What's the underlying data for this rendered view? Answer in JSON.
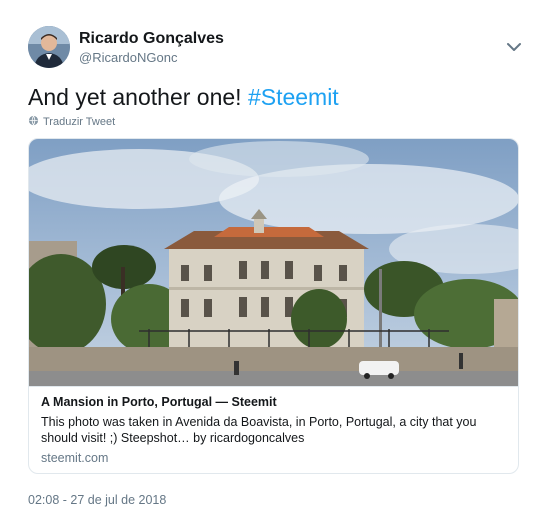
{
  "author": {
    "display_name": "Ricardo Gonçalves",
    "handle": "@RicardoNGonc"
  },
  "tweet": {
    "text_plain": "And yet another one! ",
    "hashtag": "#Steemit",
    "translate_label": "Traduzir Tweet",
    "timestamp": "02:08 - 27 de jul de 2018"
  },
  "card": {
    "title": "A Mansion in Porto, Portugal — Steemit",
    "description": "This photo was taken in Avenida da Boavista, in Porto, Portugal, a city that you should visit! ;) Steepshot… by ricardogoncalves",
    "domain": "steemit.com"
  },
  "icons": {
    "caret": "chevron-down-icon",
    "translate": "globe-icon"
  },
  "colors": {
    "link": "#1da1f2",
    "secondary_text": "#657786",
    "border": "#e1e8ed"
  }
}
